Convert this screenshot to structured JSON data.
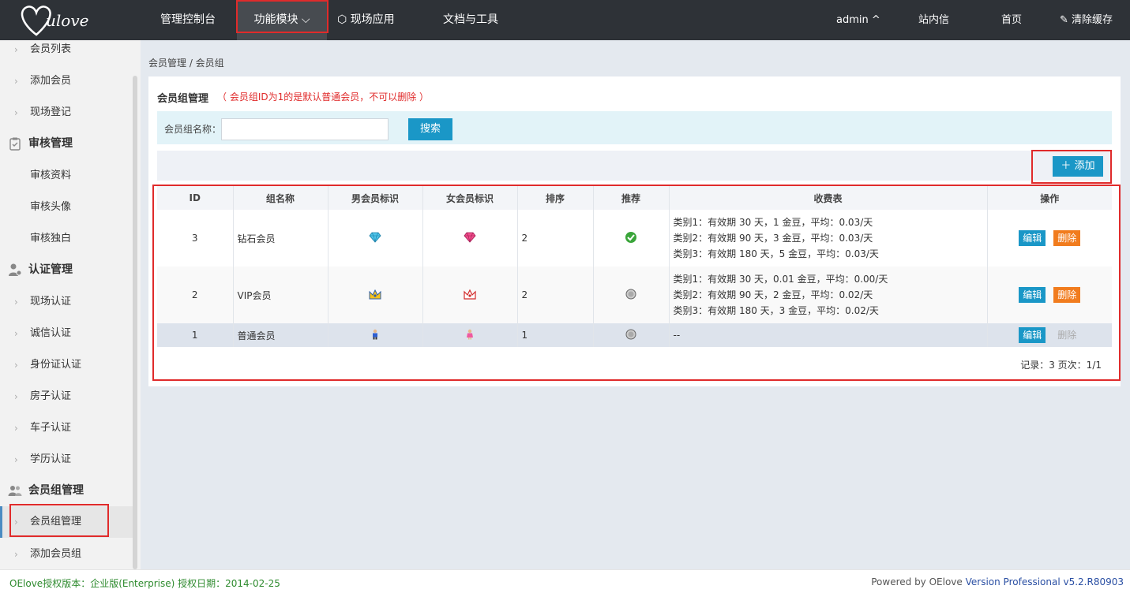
{
  "topbar": {
    "logo_text": "ulove",
    "nav": [
      "管理控制台",
      "功能模块",
      "现场应用",
      "文档与工具"
    ],
    "user": "admin",
    "messages": "站内信",
    "home": "首页",
    "clear_cache": "清除缓存"
  },
  "sidebar": {
    "items_top": [
      "会员列表",
      "添加会员",
      "现场登记"
    ],
    "group_audit": "审核管理",
    "audit_items": [
      "审核资料",
      "审核头像",
      "审核独白"
    ],
    "group_cert": "认证管理",
    "cert_items": [
      "现场认证",
      "诚信认证",
      "身份证认证",
      "房子认证",
      "车子认证",
      "学历认证"
    ],
    "group_member": "会员组管理",
    "member_items": [
      "会员组管理",
      "添加会员组"
    ]
  },
  "breadcrumb": "会员管理 / 会员组",
  "panel": {
    "title": "会员组管理",
    "note": "（ 会员组ID为1的是默认普通会员，不可以删除 ）",
    "search_label": "会员组名称：",
    "search_value": "",
    "search_button": "搜索",
    "add_button": "添加"
  },
  "table": {
    "headers": [
      "ID",
      "组名称",
      "男会员标识",
      "女会员标识",
      "排序",
      "推荐",
      "收费表",
      "操作"
    ],
    "rows": [
      {
        "id": "3",
        "name": "钻石会员",
        "sort": "2",
        "fees": [
          "类别1：有效期 30 天，1 金豆，平均：0.03/天",
          "类别2：有效期 90 天，3 金豆，平均：0.03/天",
          "类别3：有效期 180 天，5 金豆，平均：0.03/天"
        ],
        "edit": "编辑",
        "delete": "删除"
      },
      {
        "id": "2",
        "name": "VIP会员",
        "sort": "2",
        "fees": [
          "类别1：有效期 30 天，0.01 金豆，平均：0.00/天",
          "类别2：有效期 90 天，2 金豆，平均：0.02/天",
          "类别3：有效期 180 天，3 金豆，平均：0.02/天"
        ],
        "edit": "编辑",
        "delete": "删除"
      },
      {
        "id": "1",
        "name": "普通会员",
        "sort": "1",
        "fees": [
          "--"
        ],
        "edit": "编辑",
        "delete": "删除"
      }
    ],
    "record_info": "记录：3  页次：1/1"
  },
  "footer": {
    "license": "OElove授权版本：企业版(Enterprise) 授权日期：2014-02-25",
    "powered": "Powered by OElove ",
    "version": "Version Professional v5.2.R80903"
  }
}
